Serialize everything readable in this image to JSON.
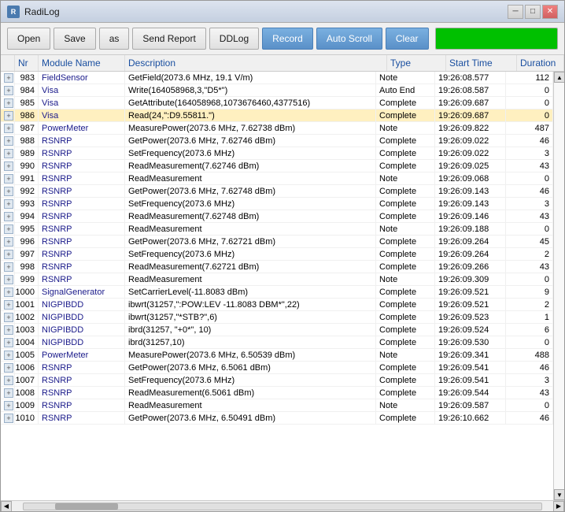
{
  "window": {
    "title": "RadiLog",
    "icon": "R"
  },
  "toolbar": {
    "open_label": "Open",
    "save_label": "Save",
    "as_label": "as",
    "send_report_label": "Send Report",
    "ddlog_label": "DDLog",
    "record_label": "Record",
    "auto_scroll_label": "Auto Scroll",
    "clear_label": "Clear"
  },
  "title_buttons": {
    "minimize": "─",
    "maximize": "□",
    "close": "✕"
  },
  "table": {
    "columns": [
      "",
      "Nr",
      "Module Name",
      "Description",
      "Type",
      "Start Time",
      "Duration"
    ],
    "rows": [
      {
        "expand": true,
        "nr": "983",
        "module": "FieldSensor",
        "desc": "GetField(2073.6 MHz, 19.1 V/m)",
        "type": "Note",
        "start": "19:26:08.577",
        "duration": "112",
        "selected": false
      },
      {
        "expand": true,
        "nr": "984",
        "module": "Visa",
        "desc": "Write(164058968,3,\"D5*\")",
        "type": "Auto End",
        "start": "19:26:08.587",
        "duration": "0",
        "selected": false
      },
      {
        "expand": true,
        "nr": "985",
        "module": "Visa",
        "desc": "GetAttribute(164058968,1073676460,4377516)",
        "type": "Complete",
        "start": "19:26:09.687",
        "duration": "0",
        "selected": false
      },
      {
        "expand": true,
        "nr": "986",
        "module": "Visa",
        "desc": "Read(24,\":D9.55811.\")",
        "type": "Complete",
        "start": "19:26:09.687",
        "duration": "0",
        "selected": true,
        "highlighted": true
      },
      {
        "expand": true,
        "nr": "987",
        "module": "PowerMeter",
        "desc": "MeasurePower(2073.6 MHz, 7.62738 dBm)",
        "type": "Note",
        "start": "19:26:09.822",
        "duration": "487",
        "selected": false
      },
      {
        "expand": true,
        "nr": "988",
        "module": "RSNRP",
        "desc": "GetPower(2073.6 MHz, 7.62746 dBm)",
        "type": "Complete",
        "start": "19:26:09.022",
        "duration": "46",
        "selected": false
      },
      {
        "expand": true,
        "nr": "989",
        "module": "RSNRP",
        "desc": "SetFrequency(2073.6 MHz)",
        "type": "Complete",
        "start": "19:26:09.022",
        "duration": "3",
        "selected": false
      },
      {
        "expand": true,
        "nr": "990",
        "module": "RSNRP",
        "desc": "ReadMeasurement(7.62746 dBm)",
        "type": "Complete",
        "start": "19:26:09.025",
        "duration": "43",
        "selected": false
      },
      {
        "expand": true,
        "nr": "991",
        "module": "RSNRP",
        "desc": "ReadMeasurement",
        "type": "Note",
        "start": "19:26:09.068",
        "duration": "0",
        "selected": false
      },
      {
        "expand": true,
        "nr": "992",
        "module": "RSNRP",
        "desc": "GetPower(2073.6 MHz, 7.62748 dBm)",
        "type": "Complete",
        "start": "19:26:09.143",
        "duration": "46",
        "selected": false
      },
      {
        "expand": true,
        "nr": "993",
        "module": "RSNRP",
        "desc": "SetFrequency(2073.6 MHz)",
        "type": "Complete",
        "start": "19:26:09.143",
        "duration": "3",
        "selected": false
      },
      {
        "expand": true,
        "nr": "994",
        "module": "RSNRP",
        "desc": "ReadMeasurement(7.62748 dBm)",
        "type": "Complete",
        "start": "19:26:09.146",
        "duration": "43",
        "selected": false
      },
      {
        "expand": true,
        "nr": "995",
        "module": "RSNRP",
        "desc": "ReadMeasurement",
        "type": "Note",
        "start": "19:26:09.188",
        "duration": "0",
        "selected": false
      },
      {
        "expand": true,
        "nr": "996",
        "module": "RSNRP",
        "desc": "GetPower(2073.6 MHz, 7.62721 dBm)",
        "type": "Complete",
        "start": "19:26:09.264",
        "duration": "45",
        "selected": false
      },
      {
        "expand": true,
        "nr": "997",
        "module": "RSNRP",
        "desc": "SetFrequency(2073.6 MHz)",
        "type": "Complete",
        "start": "19:26:09.264",
        "duration": "2",
        "selected": false
      },
      {
        "expand": true,
        "nr": "998",
        "module": "RSNRP",
        "desc": "ReadMeasurement(7.62721 dBm)",
        "type": "Complete",
        "start": "19:26:09.266",
        "duration": "43",
        "selected": false
      },
      {
        "expand": true,
        "nr": "999",
        "module": "RSNRP",
        "desc": "ReadMeasurement",
        "type": "Note",
        "start": "19:26:09.309",
        "duration": "0",
        "selected": false
      },
      {
        "expand": true,
        "nr": "1000",
        "module": "SignalGenerator",
        "desc": "SetCarrierLevel(-11.8083 dBm)",
        "type": "Complete",
        "start": "19:26:09.521",
        "duration": "9",
        "selected": false
      },
      {
        "expand": true,
        "nr": "1001",
        "module": "NIGPIBDD",
        "desc": "ibwrt(31257,\":POW:LEV -11.8083 DBM*\",22)",
        "type": "Complete",
        "start": "19:26:09.521",
        "duration": "2",
        "selected": false
      },
      {
        "expand": true,
        "nr": "1002",
        "module": "NIGPIBDD",
        "desc": "ibwrt(31257,\"*STB?\",6)",
        "type": "Complete",
        "start": "19:26:09.523",
        "duration": "1",
        "selected": false
      },
      {
        "expand": true,
        "nr": "1003",
        "module": "NIGPIBDD",
        "desc": "ibrd(31257, \"+0*\", 10)",
        "type": "Complete",
        "start": "19:26:09.524",
        "duration": "6",
        "selected": false
      },
      {
        "expand": true,
        "nr": "1004",
        "module": "NIGPIBDD",
        "desc": "ibrd(31257,10)",
        "type": "Complete",
        "start": "19:26:09.530",
        "duration": "0",
        "selected": false
      },
      {
        "expand": true,
        "nr": "1005",
        "module": "PowerMeter",
        "desc": "MeasurePower(2073.6 MHz, 6.50539 dBm)",
        "type": "Note",
        "start": "19:26:09.341",
        "duration": "488",
        "selected": false
      },
      {
        "expand": true,
        "nr": "1006",
        "module": "RSNRP",
        "desc": "GetPower(2073.6 MHz, 6.5061 dBm)",
        "type": "Complete",
        "start": "19:26:09.541",
        "duration": "46",
        "selected": false
      },
      {
        "expand": true,
        "nr": "1007",
        "module": "RSNRP",
        "desc": "SetFrequency(2073.6 MHz)",
        "type": "Complete",
        "start": "19:26:09.541",
        "duration": "3",
        "selected": false
      },
      {
        "expand": true,
        "nr": "1008",
        "module": "RSNRP",
        "desc": "ReadMeasurement(6.5061 dBm)",
        "type": "Complete",
        "start": "19:26:09.544",
        "duration": "43",
        "selected": false
      },
      {
        "expand": true,
        "nr": "1009",
        "module": "RSNRP",
        "desc": "ReadMeasurement",
        "type": "Note",
        "start": "19:26:09.587",
        "duration": "0",
        "selected": false
      },
      {
        "expand": true,
        "nr": "1010",
        "module": "RSNRP",
        "desc": "GetPower(2073.6 MHz, 6.50491 dBm)",
        "type": "Complete",
        "start": "19:26:10.662",
        "duration": "46",
        "selected": false
      }
    ]
  }
}
